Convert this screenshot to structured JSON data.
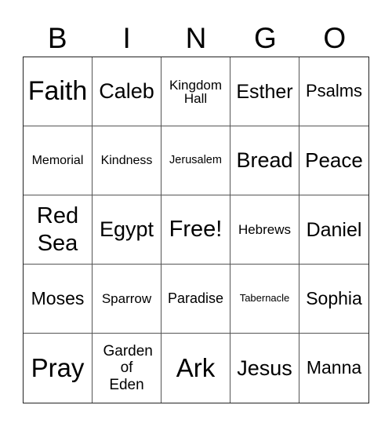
{
  "title_letters": [
    "B",
    "I",
    "N",
    "G",
    "O"
  ],
  "cells": [
    {
      "text": "Faith",
      "size": 34
    },
    {
      "text": "Caleb",
      "size": 27
    },
    {
      "text": "Kingdom Hall",
      "size": 17
    },
    {
      "text": "Esther",
      "size": 25
    },
    {
      "text": "Psalms",
      "size": 22
    },
    {
      "text": "Memorial",
      "size": 16
    },
    {
      "text": "Kindness",
      "size": 16
    },
    {
      "text": "Jerusalem",
      "size": 14.5
    },
    {
      "text": "Bread",
      "size": 27
    },
    {
      "text": "Peace",
      "size": 26
    },
    {
      "text": "Red Sea",
      "size": 29
    },
    {
      "text": "Egypt",
      "size": 27
    },
    {
      "text": "Free!",
      "size": 29
    },
    {
      "text": "Hebrews",
      "size": 17
    },
    {
      "text": "Daniel",
      "size": 25
    },
    {
      "text": "Moses",
      "size": 23
    },
    {
      "text": "Sparrow",
      "size": 17
    },
    {
      "text": "Paradise",
      "size": 18
    },
    {
      "text": "Tabernacle",
      "size": 13
    },
    {
      "text": "Sophia",
      "size": 23
    },
    {
      "text": "Pray",
      "size": 33
    },
    {
      "text": "Garden of Eden",
      "size": 19
    },
    {
      "text": "Ark",
      "size": 33
    },
    {
      "text": "Jesus",
      "size": 27
    },
    {
      "text": "Manna",
      "size": 23
    }
  ]
}
